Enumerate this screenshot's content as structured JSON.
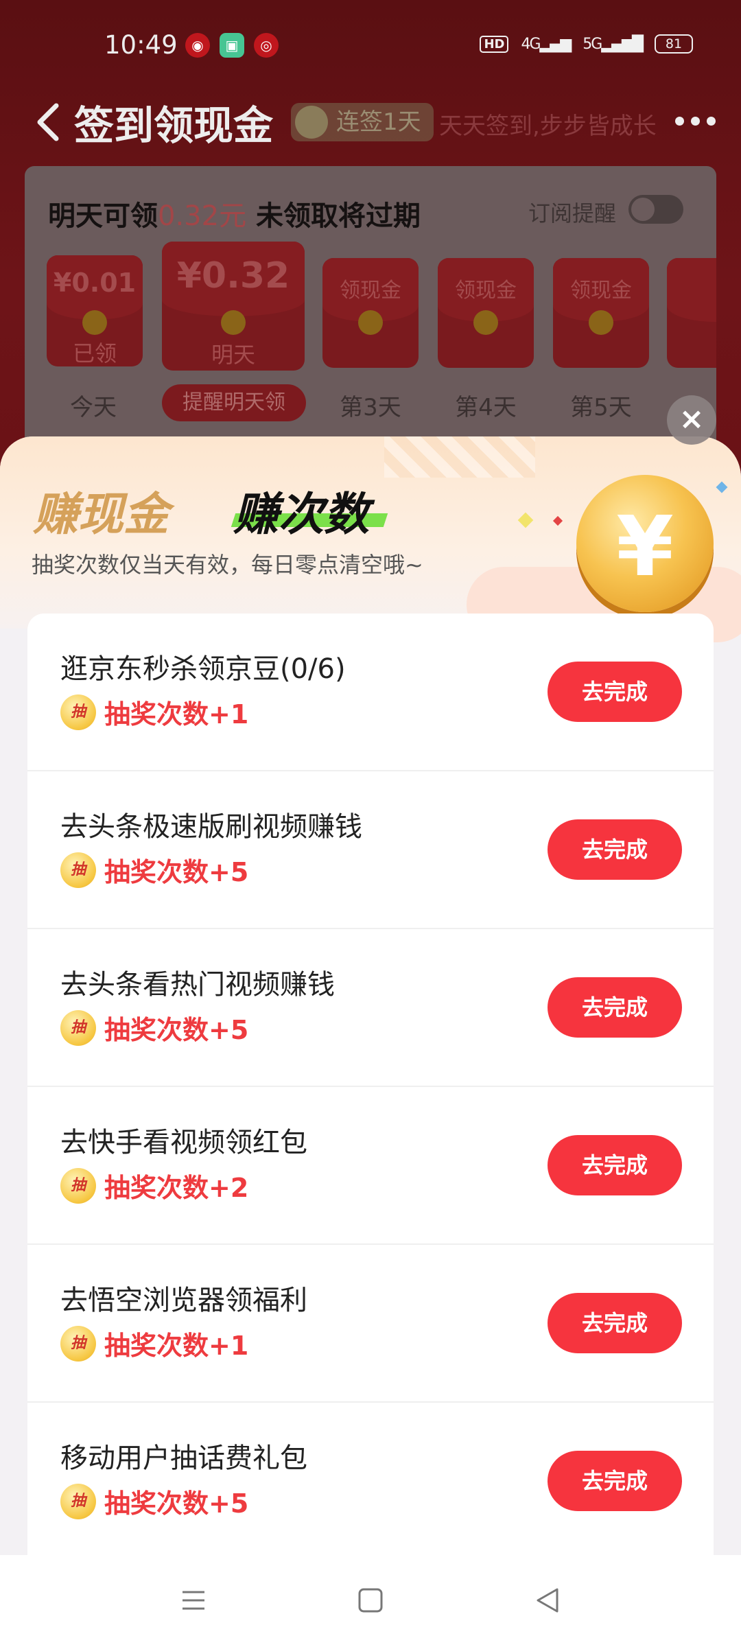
{
  "status_bar": {
    "time": "10:49",
    "hd": "HD",
    "net1": "4G",
    "net2": "5G",
    "battery": "81"
  },
  "nav": {
    "title": "签到领现金",
    "streak": "连签1天",
    "slogan": "天天签到,步步皆成长"
  },
  "sign_card": {
    "headline_pre": "明天可领",
    "headline_amount": "0.32元",
    "headline_post": " 未领取将过期",
    "remind_label": "订阅提醒",
    "packets": [
      {
        "amount": "¥0.01",
        "status": "已领",
        "day": "今天"
      },
      {
        "amount": "¥0.32",
        "status": "明天",
        "day": "提醒明天领"
      },
      {
        "amount": "领现金",
        "status": "",
        "day": "第3天"
      },
      {
        "amount": "领现金",
        "status": "",
        "day": "第4天"
      },
      {
        "amount": "领现金",
        "status": "",
        "day": "第5天"
      }
    ]
  },
  "sheet": {
    "close": "×",
    "tab_cash": "赚现金",
    "tab_count": "赚次数",
    "subtitle": "抽奖次数仅当天有效，每日零点清空哦~",
    "coin_symbol": "¥",
    "draw_glyph": "抽",
    "tasks": [
      {
        "title": "逛京东秒杀领京豆(0/6)",
        "reward": "抽奖次数+1",
        "button": "去完成"
      },
      {
        "title": "去头条极速版刷视频赚钱",
        "reward": "抽奖次数+5",
        "button": "去完成"
      },
      {
        "title": "去头条看热门视频赚钱",
        "reward": "抽奖次数+5",
        "button": "去完成"
      },
      {
        "title": "去快手看视频领红包",
        "reward": "抽奖次数+2",
        "button": "去完成"
      },
      {
        "title": "去悟空浏览器领福利",
        "reward": "抽奖次数+1",
        "button": "去完成"
      },
      {
        "title": "移动用户抽话费礼包",
        "reward": "抽奖次数+5",
        "button": "去完成"
      }
    ]
  },
  "colors": {
    "accent_red": "#f6343e",
    "reward_red": "#ee3b3f",
    "gold": "#d5a15a",
    "highlight_green": "#7be04a"
  }
}
